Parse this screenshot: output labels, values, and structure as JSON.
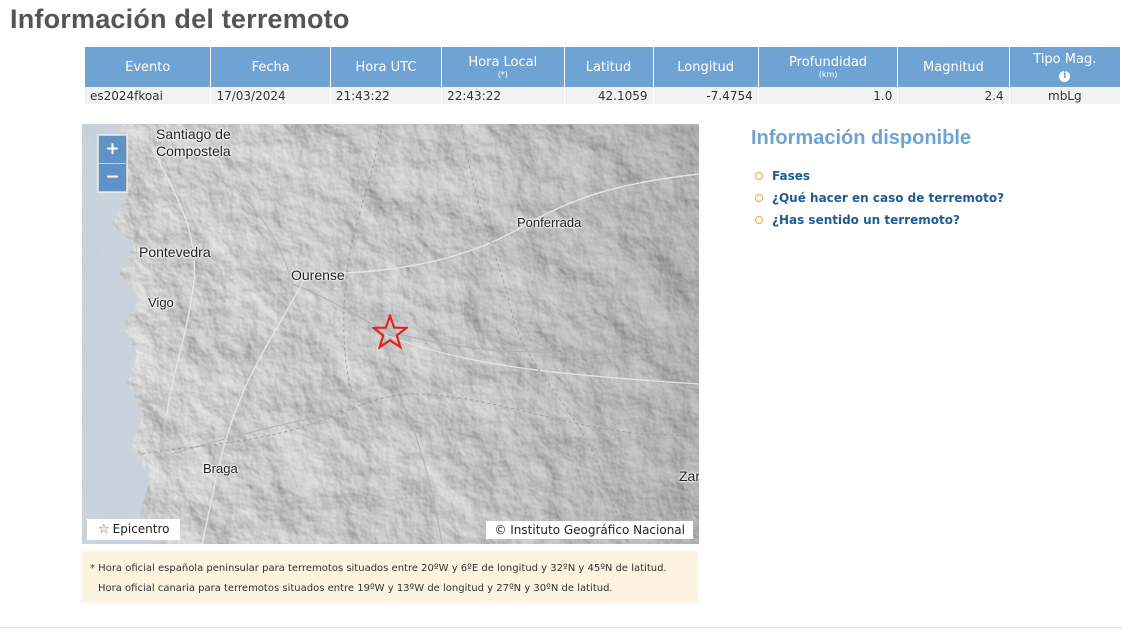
{
  "page": {
    "title": "Información del terremoto"
  },
  "table": {
    "headers": {
      "event": "Evento",
      "date": "Fecha",
      "utc": "Hora UTC",
      "local": "Hora Local",
      "local_note": "(*)",
      "lat": "Latitud",
      "lon": "Longitud",
      "depth": "Profundidad",
      "depth_unit": "(km)",
      "mag": "Magnitud",
      "magtype": "Tipo Mag.",
      "magtype_icon": "info-icon"
    },
    "row": {
      "event": "es2024fkoai",
      "date": "17/03/2024",
      "utc": "21:43:22",
      "local": "22:43:22",
      "lat": "42.1059",
      "lon": "-7.4754",
      "depth": "1.0",
      "mag": "2.4",
      "magtype": "mbLg"
    }
  },
  "map": {
    "cities": {
      "santiago_1": "Santiago de",
      "santiago_2": "Compostela",
      "pontevedra": "Pontevedra",
      "vigo": "Vigo",
      "ourense": "Ourense",
      "ponferrada": "Ponferrada",
      "braga": "Braga",
      "zamora_partial": "Zar"
    },
    "zoom_in": "+",
    "zoom_out": "−",
    "legend": "Epicentro",
    "legend_icon": "star-icon",
    "attribution": "© Instituto Geográfico Nacional",
    "epicenter_color": "#e32222"
  },
  "note": {
    "line1": "* Hora oficial española peninsular para terremotos situados entre 20ºW y 6ºE de longitud y 32ºN y 45ºN de latitud.",
    "line2": "Hora oficial canaria para terremotos situados entre 19ºW y 13ºW de longitud y 27ºN y 30ºN de latitud."
  },
  "sidebar": {
    "heading": "Información disponible",
    "links": [
      "Fases",
      "¿Qué hacer en caso de terremoto?",
      "¿Has sentido un terremoto?"
    ]
  },
  "colors": {
    "header_blue": "#6ea3d4",
    "link_blue": "#1e5c93",
    "bullet_orange": "#f0a436",
    "note_bg": "#fdf3e1"
  }
}
